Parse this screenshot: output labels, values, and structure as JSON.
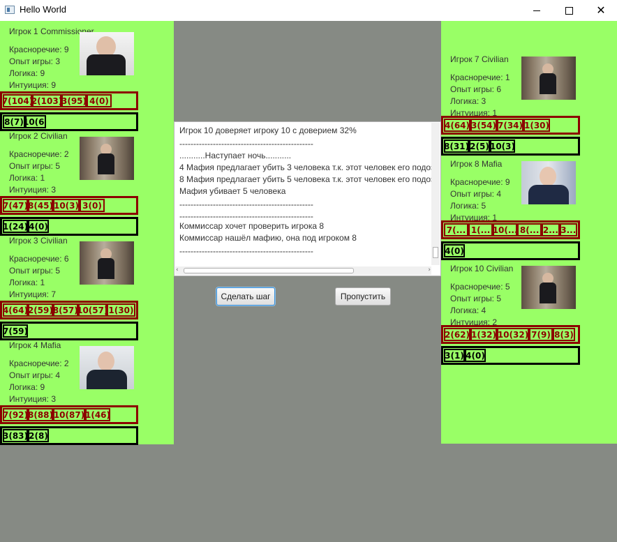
{
  "window": {
    "title": "Hello World",
    "minimize": "—",
    "maximize": "□",
    "close": "✕"
  },
  "left_players": [
    {
      "name": "Игрок 1 Commissioner",
      "photo": "commissioner-photo",
      "stats": [
        "Красноречие:  9",
        "Опыт игры:  3",
        "Логика:  9",
        "Интуиция:  9"
      ],
      "red": [
        "7(104)",
        "2(103)",
        "3(95)",
        "4(0)"
      ],
      "black": [
        "8(7)",
        "10(6)"
      ]
    },
    {
      "name": "Игрок 2 Civilian",
      "photo": "civilian-photo",
      "stats": [
        "Красноречие:  2",
        "Опыт игры:  5",
        "Логика:  1",
        "Интуиция:  3"
      ],
      "red": [
        "7(47)",
        "8(45)",
        "10(3)",
        "3(0)"
      ],
      "black": [
        "1(24)",
        "4(0)"
      ]
    },
    {
      "name": "Игрок 3 Civilian",
      "photo": "civilian-photo",
      "stats": [
        "Красноречие:  6",
        "Опыт игры:  5",
        "Логика:  1",
        "Интуиция:  7"
      ],
      "red": [
        "4(64)",
        "2(59)",
        "8(57)",
        "10(57)",
        "1(30)"
      ],
      "black": [
        "7(59)"
      ]
    },
    {
      "name": "Игрок 4 Mafia",
      "photo": "mafia-photo",
      "stats": [
        "Красноречие:  2",
        "Опыт игры:  4",
        "Логика:  9",
        "Интуиция:  3"
      ],
      "red": [
        "7(92)",
        "8(88)",
        "10(87)",
        "1(46)"
      ],
      "black": [
        "3(83)",
        "2(8)"
      ]
    }
  ],
  "right_players": [
    {
      "name": "Игрок 7 Civilian",
      "photo": "civilian-photo",
      "stats": [
        "Красноречие:  1",
        "Опыт игры:  6",
        "Логика:  3",
        "Интуиция:  1"
      ],
      "red": [
        "4(64)",
        "3(54)",
        "7(34)",
        "1(30)"
      ],
      "black": [
        "8(31)",
        "2(5)",
        "10(3)"
      ]
    },
    {
      "name": "Игрок 8 Mafia",
      "photo": "mafia-photo",
      "stats": [
        "Красноречие:  9",
        "Опыт игры:  4",
        "Логика:  5",
        "Интуиция:  1"
      ],
      "red": [
        "7(...",
        "1(...",
        "10(...",
        "8(...",
        "2...",
        "3..."
      ],
      "black": [
        "4(0)"
      ]
    },
    {
      "name": "Игрок 10 Civilian",
      "photo": "civilian-photo",
      "stats": [
        "Красноречие:  5",
        "Опыт игры:  5",
        "Логика:  4",
        "Интуиция:  2"
      ],
      "red": [
        "2(62)",
        "1(32)",
        "10(32)",
        "7(9)",
        "8(3)"
      ],
      "black": [
        "3(1)",
        "4(0)"
      ]
    }
  ],
  "log_lines": [
    "Игрок 10 доверяет игроку 10 с доверием 32%",
    "------------------------------------------------",
    "...........Наступает ночь...........",
    "4 Мафия предлагает убить 3 человека т.к. этот человек его подоз",
    "8 Мафия предлагает убить 5 человека т.к. этот человек его подоз",
    "Мафия убивает 5 человека",
    "------------------------------------------------",
    "------------------------------------------------",
    "Коммиссар хочет проверить игрока 8",
    "Коммиссар нашёл мафию, она под игроком 8",
    "------------------------------------------------"
  ],
  "buttons": {
    "step": "Сделать шаг",
    "skip": "Пропустить"
  }
}
